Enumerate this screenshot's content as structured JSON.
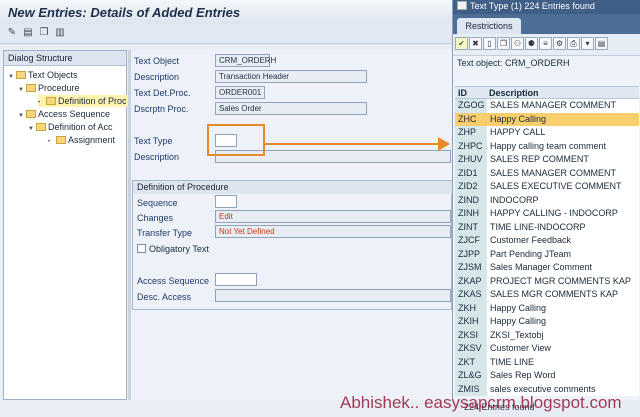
{
  "window": {
    "title": "New Entries: Details of Added Entries"
  },
  "toolbar": {
    "icons": [
      "pen-icon",
      "save-icon",
      "copy-icon",
      "info-icon"
    ]
  },
  "tree": {
    "header": "Dialog Structure",
    "items": [
      {
        "label": "Text Objects",
        "level": 0,
        "expanded": true
      },
      {
        "label": "Procedure",
        "level": 1,
        "expanded": true
      },
      {
        "label": "Definition of Proc",
        "level": 2,
        "selected": true
      },
      {
        "label": "Access Sequence",
        "level": 1,
        "expanded": true
      },
      {
        "label": "Definition of Acc",
        "level": 2,
        "expanded": true
      },
      {
        "label": "Assignment",
        "level": 3
      }
    ]
  },
  "form": {
    "text_object": {
      "label": "Text Object",
      "value": "CRM_ORDERH"
    },
    "description": {
      "label": "Description",
      "value": "Transaction Header"
    },
    "text_det_proc": {
      "label": "Text Det.Proc.",
      "value": "ORDER001"
    },
    "dscrptn_proc": {
      "label": "Dscrptn Proc.",
      "value": "Sales Order"
    },
    "text_type": {
      "label": "Text Type",
      "value": ""
    },
    "description2": {
      "label": "Description",
      "value": ""
    }
  },
  "procedure": {
    "title": "Definition of Procedure",
    "sequence": {
      "label": "Sequence",
      "value": ""
    },
    "changes": {
      "label": "Changes",
      "value": "Edit"
    },
    "transfer_type": {
      "label": "Transfer Type",
      "value": "Not Yet Defined"
    },
    "obligatory": {
      "label": "Obligatory Text"
    },
    "access_sequence": {
      "label": "Access Sequence",
      "value": ""
    },
    "desc_access": {
      "label": "Desc. Access",
      "value": ""
    }
  },
  "popup": {
    "title": "Text Type (1)  224 Entries found",
    "tab": "Restrictions",
    "text_object": "Text object: CRM_ORDERH",
    "col_id": "ID",
    "col_desc": "Description",
    "rows": [
      {
        "id": "ZGOG",
        "desc": "SALES MANAGER COMMENT"
      },
      {
        "id": "ZHC",
        "desc": "Happy Calling",
        "selected": true
      },
      {
        "id": "ZHP",
        "desc": "HAPPY CALL"
      },
      {
        "id": "ZHPC",
        "desc": "Happy calling team comment"
      },
      {
        "id": "ZHUV",
        "desc": "SALES REP COMMENT"
      },
      {
        "id": "ZID1",
        "desc": "SALES MANAGER COMMENT"
      },
      {
        "id": "ZID2",
        "desc": "SALES EXECUTIVE COMMENT"
      },
      {
        "id": "ZIND",
        "desc": "INDOCORP"
      },
      {
        "id": "ZINH",
        "desc": "HAPPY CALLING - INDOCORP"
      },
      {
        "id": "ZINT",
        "desc": "TIME LINE-INDOCORP"
      },
      {
        "id": "ZJCF",
        "desc": "Customer Feedback"
      },
      {
        "id": "ZJPP",
        "desc": "Part Pending JTeam"
      },
      {
        "id": "ZJSM",
        "desc": "Sales Manager Comment"
      },
      {
        "id": "ZKAP",
        "desc": "PROJECT MGR COMMENTS KAP"
      },
      {
        "id": "ZKAS",
        "desc": "SALES MGR COMMENTS KAP"
      },
      {
        "id": "ZKH",
        "desc": "Happy Calling"
      },
      {
        "id": "ZKIH",
        "desc": "Happy Calling"
      },
      {
        "id": "ZKSI",
        "desc": "ZKSI_Textobj"
      },
      {
        "id": "ZKSV",
        "desc": "Customer View"
      },
      {
        "id": "ZKT",
        "desc": "TIME LINE"
      },
      {
        "id": "ZL&G",
        "desc": "Sales Rep Word"
      },
      {
        "id": "ZMIS",
        "desc": "sales executive comments"
      }
    ],
    "footer": "224 Entries found"
  },
  "watermark": "Abhishek.. easysapcrm.blogspot.com",
  "colors": {
    "accent": "#e88a2a",
    "selected_row": "#f9cf6e",
    "popup_title": "#3f5f86"
  }
}
